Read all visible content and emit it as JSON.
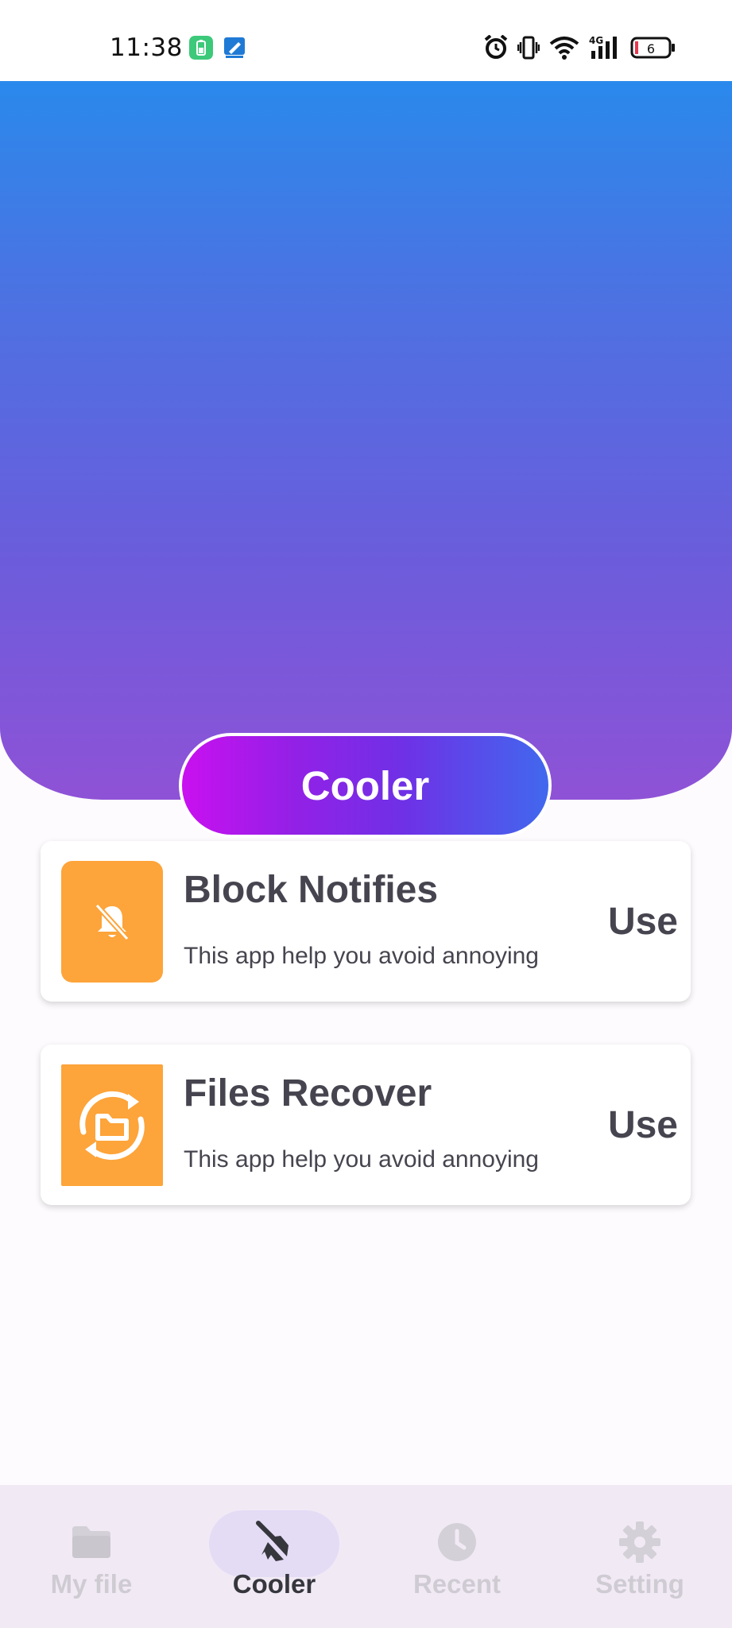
{
  "status_bar": {
    "time": "11:38",
    "battery_level": "6",
    "network_type": "4G"
  },
  "hero": {
    "button_label": "Cooler"
  },
  "features": [
    {
      "title": "Block Notifies",
      "description": "This app help you avoid annoying",
      "action": "Use",
      "icon": "bell-off-icon",
      "icon_bg": "#fda43a"
    },
    {
      "title": "Files Recover",
      "description": "This app help you avoid annoying",
      "action": "Use",
      "icon": "folder-recover-icon",
      "icon_bg": "#fda43a"
    }
  ],
  "bottom_nav": {
    "items": [
      {
        "label": "My file",
        "icon": "folder-icon",
        "active": false
      },
      {
        "label": "Cooler",
        "icon": "broom-icon",
        "active": true
      },
      {
        "label": "Recent",
        "icon": "clock-icon",
        "active": false
      },
      {
        "label": "Setting",
        "icon": "gear-icon",
        "active": false
      }
    ]
  },
  "colors": {
    "hero_gradient_top": "#2a89ec",
    "hero_gradient_bottom": "#8f52d6",
    "button_gradient_start": "#c910f0",
    "button_gradient_end": "#4168ee",
    "accent_orange": "#fda43a",
    "text_dark": "#46454f",
    "nav_inactive": "#cfcbd3",
    "nav_active_pill": "#e4dcf5"
  }
}
